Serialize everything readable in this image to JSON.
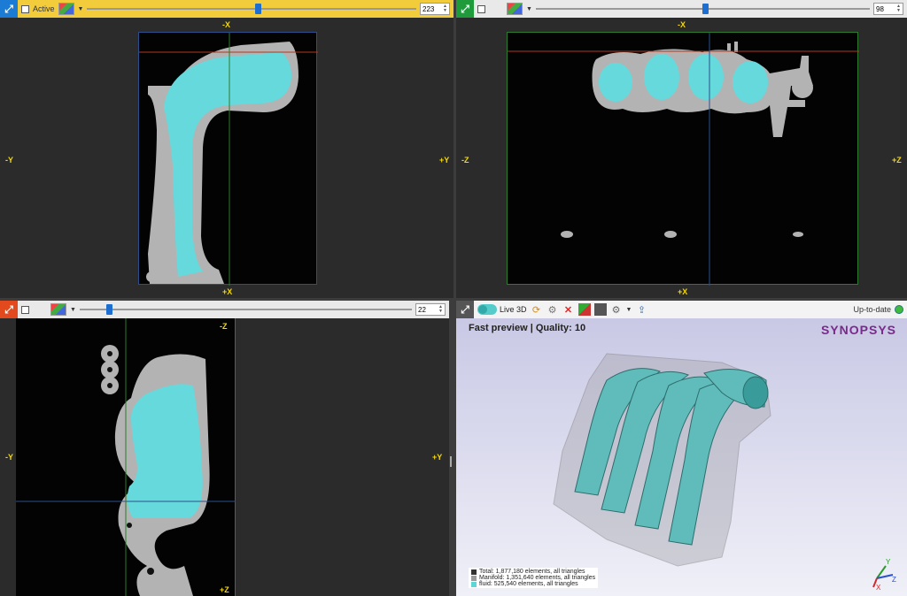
{
  "top_left": {
    "active_label": "Active",
    "slice_value": "223",
    "axes": {
      "top": "-X",
      "bottom": "+X",
      "left": "-Y",
      "right": "+Y"
    }
  },
  "top_right": {
    "slice_value": "98",
    "axes": {
      "top": "-X",
      "bottom": "+X",
      "left": "-Z",
      "right": "+Z"
    }
  },
  "bottom_left": {
    "slice_value": "22",
    "axes": {
      "top": "-Z",
      "bottom": "+Z",
      "left": "-Y",
      "right": "+Y"
    }
  },
  "view3d": {
    "live3d_label": "Live 3D",
    "status": "Up-to-date",
    "preview_label": "Fast preview | Quality: 10",
    "logo": "SYNOPSYS",
    "legend": [
      {
        "text": "Total: 1,877,180 elements, all triangles",
        "color": "#333333"
      },
      {
        "text": "Manifold: 1,351,640 elements, all triangles",
        "color": "#9a9a9a"
      },
      {
        "text": "fluid: 525,540 elements, all triangles",
        "color": "#5fd6d6"
      }
    ],
    "triad": {
      "y": "Y",
      "z": "Z",
      "x": "X"
    }
  },
  "colors": {
    "fluid": "#66d9dc",
    "manifold": "#b3b3b3",
    "crosshair_red": "#b03a1c",
    "crosshair_green": "#2e7a2e",
    "crosshair_blue": "#2a4f8a",
    "axis_label": "#f5d90a"
  }
}
